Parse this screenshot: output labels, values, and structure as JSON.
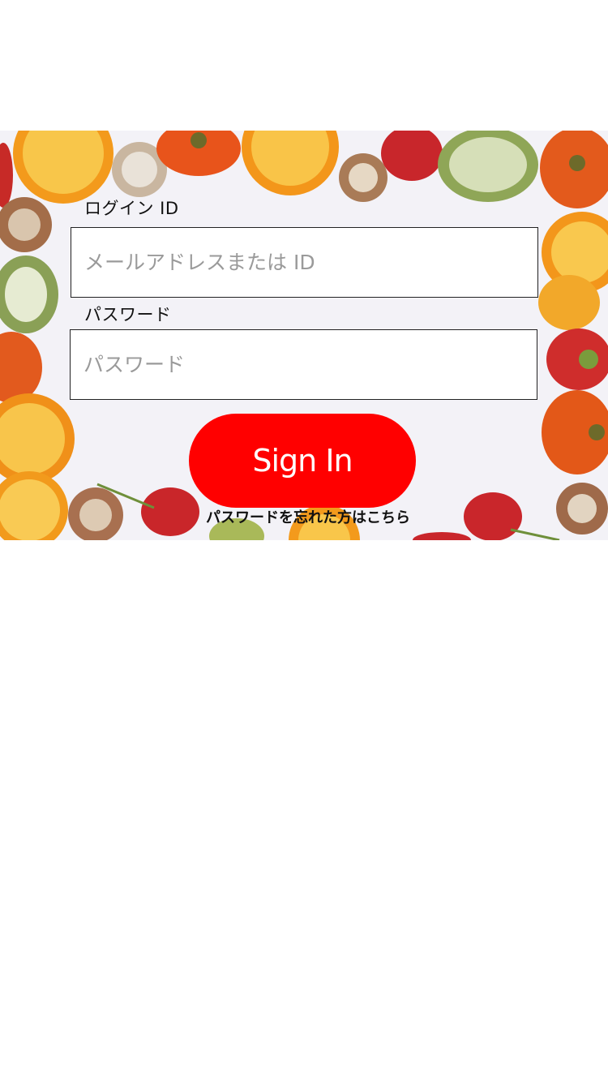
{
  "login": {
    "id_label": "ログイン ID",
    "id_placeholder": "メールアドレスまたは ID",
    "password_label": "パスワード",
    "password_placeholder": "パスワード",
    "signin_label": "Sign In",
    "forgot_link": "パスワードを忘れた方はこちら"
  },
  "colors": {
    "signin_button": "#ff0000",
    "background": "#ffffff",
    "banner_background": "#f3f2f7"
  },
  "banner": {
    "icon": "dried-fruit-frame-image"
  }
}
